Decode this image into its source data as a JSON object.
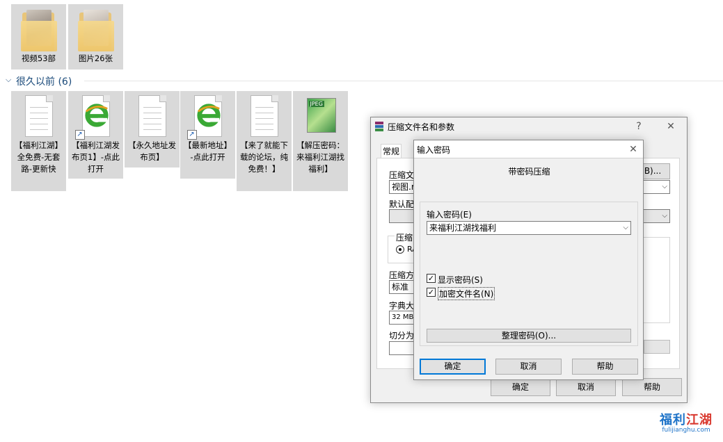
{
  "explorer": {
    "top_items": [
      {
        "label": "视频53部",
        "icon": "folder-icon"
      },
      {
        "label": "图片26张",
        "icon": "folder-icon"
      }
    ],
    "group": {
      "title": "很久以前 (6)",
      "chevron": "⌵"
    },
    "items": [
      {
        "label": "【福利江湖】全免费-无套路-更新快",
        "icon": "text-document-icon"
      },
      {
        "label": "【福利江湖发布页1】-点此打开",
        "icon": "ie-shortcut-icon"
      },
      {
        "label": "【永久地址发布页】",
        "icon": "text-document-icon"
      },
      {
        "label": "【最新地址】-点此打开",
        "icon": "ie-shortcut-icon"
      },
      {
        "label": "【来了就能下载的论坛，纯免费！】",
        "icon": "text-document-icon"
      },
      {
        "label": "【解压密码：来福利江湖找福利】",
        "icon": "jpeg-image-icon",
        "tag": "JPEG"
      }
    ]
  },
  "archive_dialog": {
    "title": "压缩文件名和参数",
    "help_glyph": "?",
    "close_glyph": "✕",
    "tab_general": "常规",
    "archive_name_label": "压缩文",
    "browse_label": "B)...",
    "archive_name_value": "视图.r",
    "default_profile_label": "默认配",
    "format_label": "压缩",
    "format_option": "RA",
    "method_label": "压缩方",
    "method_value": "标准",
    "dict_label": "字典大",
    "dict_value": "32 MB",
    "split_label": "切分为",
    "ok": "确定",
    "cancel": "取消",
    "help": "帮助"
  },
  "password_dialog": {
    "title": "输入密码",
    "close_glyph": "✕",
    "heading": "带密码压缩",
    "password_label": "输入密码(E)",
    "password_value": "来福利江湖找福利",
    "show_password_label": "显示密码(S)",
    "show_password_checked": true,
    "encrypt_names_label": "加密文件名(N)",
    "encrypt_names_checked": true,
    "organize_button": "整理密码(O)...",
    "ok": "确定",
    "cancel": "取消",
    "help": "帮助"
  },
  "watermark": {
    "title_blue": "福利",
    "title_red": "江湖",
    "url": "fulijianghu.com"
  }
}
